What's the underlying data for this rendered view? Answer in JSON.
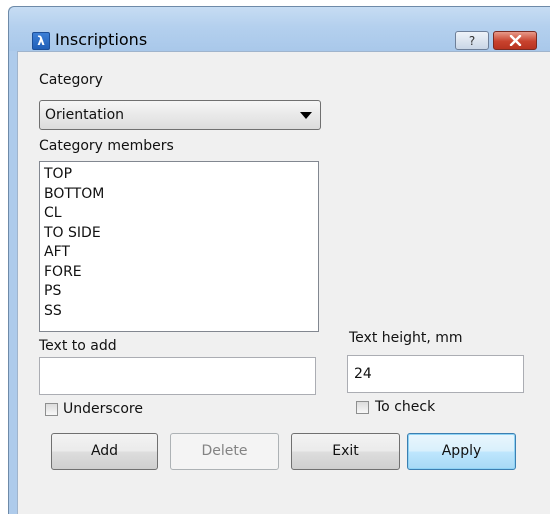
{
  "window": {
    "title": "Inscriptions",
    "help_label": "?",
    "app_icon_glyph": "λ"
  },
  "category": {
    "label": "Category",
    "selected": "Orientation"
  },
  "members": {
    "label": "Category members",
    "items": [
      "TOP",
      "BOTTOM",
      "CL",
      "TO SIDE",
      "AFT",
      "FORE",
      "PS",
      "SS"
    ]
  },
  "text_to_add": {
    "label": "Text to add",
    "value": ""
  },
  "text_height": {
    "label": "Text height, mm",
    "value": "24"
  },
  "underscore": {
    "label": "Underscore",
    "checked": false
  },
  "to_check": {
    "label": "To check",
    "checked": false
  },
  "buttons": {
    "add": "Add",
    "delete": "Delete",
    "exit": "Exit",
    "apply": "Apply"
  },
  "colors": {
    "titlebar": "#b4d0ee",
    "close_button": "#c8422d",
    "default_button_border": "#3c7fb1"
  },
  "icons": [
    "app-icon",
    "help-icon",
    "close-icon",
    "dropdown-arrow-icon"
  ]
}
